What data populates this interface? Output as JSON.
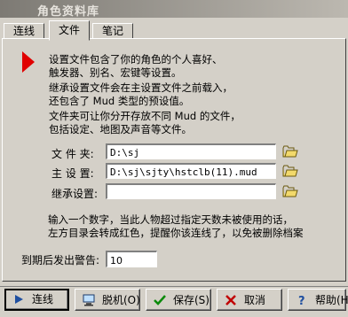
{
  "window": {
    "title": "角色资料库"
  },
  "tabs": [
    "连线",
    "文件",
    "笔记"
  ],
  "description": [
    "设置文件包含了你的角色的个人喜好、",
    "触发器、别名、宏键等设置。",
    "继承设置文件会在主设置文件之前载入，",
    "还包含了 Mud 类型的预设值。",
    "文件夹可让你分开存放不同 Mud 的文件，",
    "包括设定、地图及声音等文件。"
  ],
  "fields": {
    "folder": {
      "label": "文 件 夹:",
      "value": "D:\\sj"
    },
    "main_settings": {
      "label": "主 设 置:",
      "value": "D:\\sj\\sjty\\hstclb(11).mud"
    },
    "inherit_settings": {
      "label": "继承设置:",
      "value": ""
    }
  },
  "idle_note": [
    "输入一个数字，当此人物超过指定天数未被使用的话，",
    "左方目录会转成红色，提醒你该连线了，以免被删除档案"
  ],
  "expiry": {
    "label": "到期后发出警告:",
    "value": "10"
  },
  "buttons": {
    "connect": "连线",
    "offline": "脱机(O)",
    "save": "保存(S)",
    "cancel": "取消",
    "help": "帮助(H)"
  },
  "colors": {
    "accent_arrow": "#e00000",
    "face": "#d4d0c8"
  }
}
